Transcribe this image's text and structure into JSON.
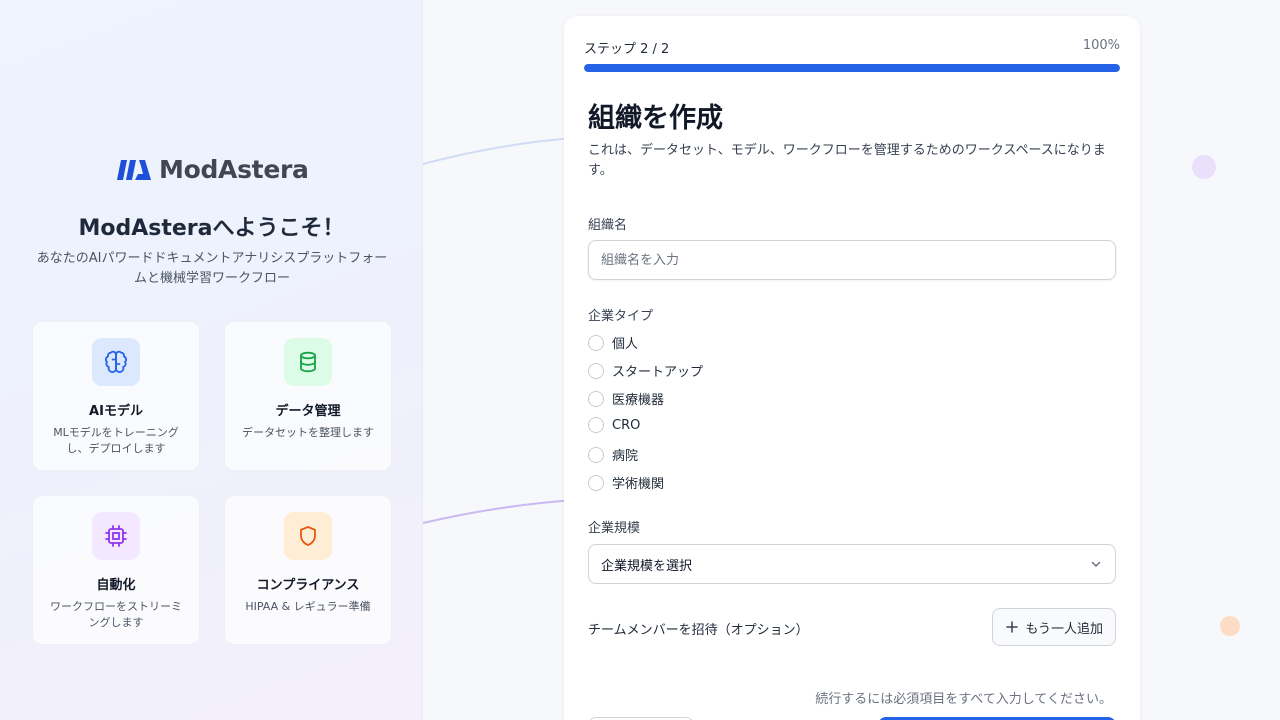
{
  "brand": {
    "name": "ModAstera"
  },
  "welcome": {
    "title": "ModAsteraへようこそ！",
    "subtitle": "あなたのAIパワードドキュメントアナリシスプラットフォームと機械学習ワークフロー"
  },
  "features": [
    {
      "icon": "brain-icon",
      "title": "AIモデル",
      "description": "MLモデルをトレーニングし、デプロイします",
      "color": "#2563eb",
      "bg": "#dbe8fd"
    },
    {
      "icon": "database-icon",
      "title": "データ管理",
      "description": "データセットを整理します",
      "color": "#16a34a",
      "bg": "#dcfce7"
    },
    {
      "icon": "cpu-chip-icon",
      "title": "自動化",
      "description": "ワークフローをストリーミングします",
      "color": "#9333ea",
      "bg": "#f3e8ff"
    },
    {
      "icon": "shield-icon",
      "title": "コンプライアンス",
      "description": "HIPAA & レギュラー準備",
      "color": "#ea580c",
      "bg": "#ffedd5"
    }
  ],
  "progress": {
    "step_label": "ステップ 2 / 2",
    "percent_label": "100%",
    "value": 1.0,
    "color": "#2463e6"
  },
  "form": {
    "title": "組織を作成",
    "description": "これは、データセット、モデル、ワークフローを管理するためのワークスペースになります。",
    "org_name": {
      "label": "組織名",
      "placeholder": "組織名を入力",
      "value": ""
    },
    "company_type": {
      "label": "企業タイプ",
      "options": [
        "個人",
        "スタートアップ",
        "医療機器",
        "CRO",
        "病院",
        "学術機関"
      ]
    },
    "company_size": {
      "label": "企業規模",
      "selected": "企業規模を選択"
    },
    "team": {
      "label": "チームメンバーを招待（オプション）",
      "add_label": "もう一人追加"
    },
    "hint": "続行するには必須項目をすべて入力してください。"
  }
}
